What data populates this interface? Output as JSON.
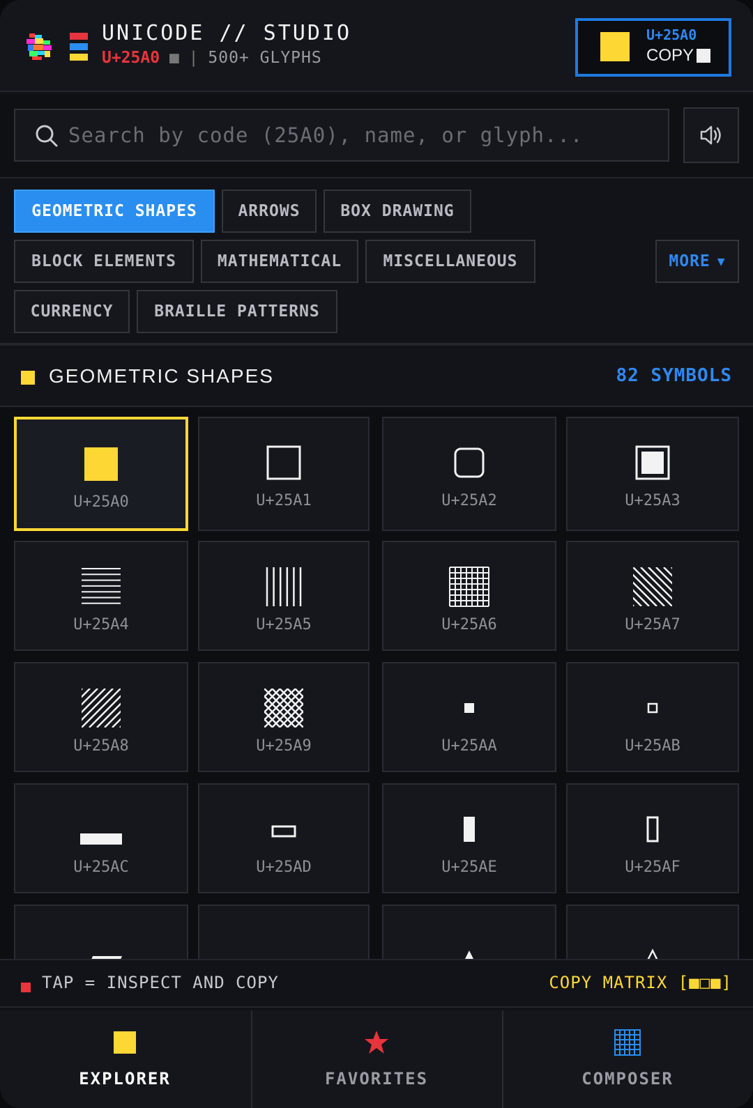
{
  "header": {
    "app_title": "UNICODE // STUDIO",
    "current_code": "U+25A0",
    "current_glyph": "■",
    "separator": "|",
    "glyph_count": "500+ GLYPHS",
    "copy_card": {
      "code": "U+25A0",
      "label": "COPY"
    }
  },
  "search": {
    "placeholder": "Search by code (25A0), name, or glyph..."
  },
  "categories": {
    "items": [
      {
        "label": "GEOMETRIC SHAPES",
        "active": true
      },
      {
        "label": "ARROWS"
      },
      {
        "label": "BOX DRAWING"
      },
      {
        "label": "BLOCK ELEMENTS"
      },
      {
        "label": "MATHEMATICAL"
      },
      {
        "label": "MISCELLANEOUS"
      },
      {
        "label": "CURRENCY"
      },
      {
        "label": "BRAILLE PATTERNS"
      }
    ],
    "more_label": "MORE",
    "more_caret": "▼"
  },
  "section": {
    "title": "GEOMETRIC SHAPES",
    "count": "82 SYMBOLS"
  },
  "glyphs": [
    {
      "code": "U+25A0",
      "icon": "black-square"
    },
    {
      "code": "U+25A1",
      "icon": "white-square"
    },
    {
      "code": "U+25A2",
      "icon": "rounded-square"
    },
    {
      "code": "U+25A3",
      "icon": "square-containing-square"
    },
    {
      "code": "U+25A4",
      "icon": "horizontal-fill-square"
    },
    {
      "code": "U+25A5",
      "icon": "vertical-fill-square"
    },
    {
      "code": "U+25A6",
      "icon": "crosshatch-square"
    },
    {
      "code": "U+25A7",
      "icon": "diagonal-down-fill-square"
    },
    {
      "code": "U+25A8",
      "icon": "diagonal-up-fill-square"
    },
    {
      "code": "U+25A9",
      "icon": "diagonal-crosshatch-square"
    },
    {
      "code": "U+25AA",
      "icon": "black-small-square"
    },
    {
      "code": "U+25AB",
      "icon": "white-small-square"
    },
    {
      "code": "U+25AC",
      "icon": "black-rectangle"
    },
    {
      "code": "U+25AD",
      "icon": "white-rectangle"
    },
    {
      "code": "U+25AE",
      "icon": "black-vertical-rectangle"
    },
    {
      "code": "U+25AF",
      "icon": "white-vertical-rectangle"
    },
    {
      "code": "",
      "icon": "black-parallelogram"
    },
    {
      "code": "",
      "icon": "white-parallelogram"
    },
    {
      "code": "",
      "icon": "black-triangle"
    },
    {
      "code": "",
      "icon": "white-triangle"
    }
  ],
  "selected_glyph": "U+25A0",
  "hint": {
    "text": "TAP = INSPECT AND COPY",
    "matrix_label": "COPY MATRIX [■□■]"
  },
  "nav": {
    "items": [
      {
        "label": "EXPLORER",
        "icon": "square-icon",
        "active": true
      },
      {
        "label": "FAVORITES",
        "icon": "star-icon"
      },
      {
        "label": "COMPOSER",
        "icon": "grid-icon"
      }
    ]
  },
  "colors": {
    "accent_blue": "#2a8ef0",
    "accent_yellow": "#fdd835",
    "accent_red": "#e8343c",
    "background": "#111217"
  }
}
